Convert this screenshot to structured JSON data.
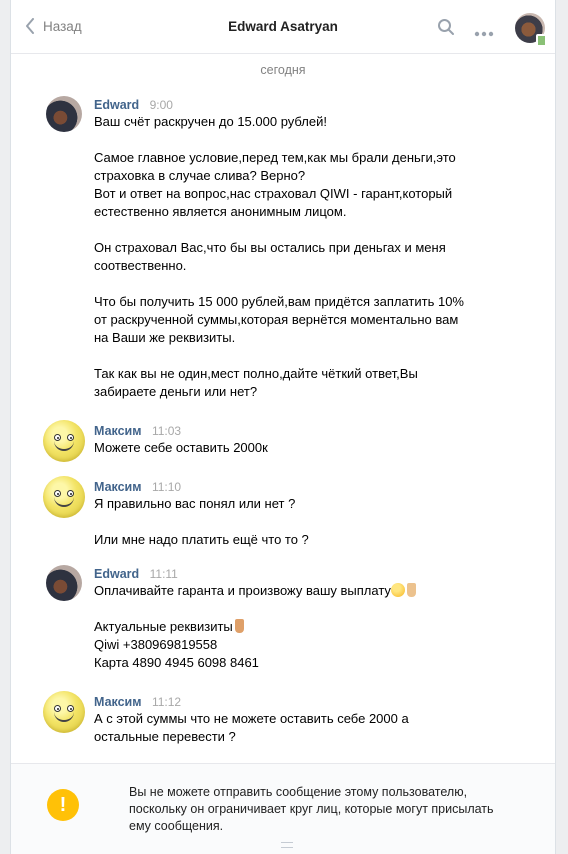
{
  "header": {
    "back_label": "Назад",
    "title": "Edward Asatryan",
    "icons": [
      "chevron-left-icon",
      "search-icon",
      "more-icon"
    ]
  },
  "date_separator": "сегодня",
  "messages": [
    {
      "author": "Edward",
      "time": "9:00",
      "avatar": "photo",
      "lines": [
        "Ваш счёт раскручен до 15.000 рублей!",
        "",
        "Самое главное условие,перед тем,как мы брали деньги,это",
        "страховка в случае слива? Верно?",
        "Вот и ответ на вопрос,нас страховал QIWI - гарант,который",
        "естественно является анонимным лицом.",
        "",
        "Он страховал Вас,что бы вы остались при деньгах и меня",
        "соотвественно.",
        "",
        "Что бы получить 15 000 рублей,вам придётся заплатить 10%",
        "от раскрученной суммы,которая вернётся моментально вам",
        "на Ваши же реквизиты.",
        "",
        "Так как вы не один,мест полно,дайте чёткий ответ,Вы",
        "забираете деньги или нет?"
      ]
    },
    {
      "author": "Максим",
      "time": "11:03",
      "avatar": "smiley",
      "lines": [
        "Можете себе оставить 2000к"
      ]
    },
    {
      "author": "Максим",
      "time": "11:10",
      "avatar": "smiley",
      "lines": [
        "Я правильно вас понял или нет ?",
        "",
        "Или мне надо платить ещё что то ?"
      ]
    },
    {
      "author": "Edward",
      "time": "11:11",
      "avatar": "photo",
      "lines": [
        "Оплачивайте гаранта и произвожу вашу выплату",
        "",
        "Актуальные реквизиты",
        "Qiwi +380969819558",
        "Карта 4890 4945 6098 8461"
      ]
    },
    {
      "author": "Максим",
      "time": "11:12",
      "avatar": "smiley",
      "lines": [
        "А с этой суммы что не можете оставить себе 2000 а",
        "остальные перевести ?"
      ]
    }
  ],
  "notice": {
    "icon": "!",
    "text_lines": [
      "Вы не можете отправить сообщение этому пользователю,",
      "поскольку он ограничивает круг лиц, которые могут присылать",
      "ему сообщения."
    ]
  },
  "colors": {
    "name_link": "#42648b",
    "time": "#a8a8a8",
    "warning": "#ffc107",
    "online": "#8ac176"
  }
}
